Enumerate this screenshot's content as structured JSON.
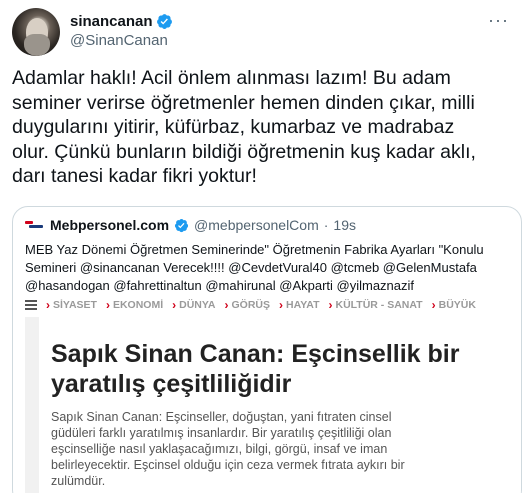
{
  "author": {
    "display_name": "sinancanan",
    "handle": "@SinanCanan",
    "verified_icon": "verified-badge-icon",
    "more_icon": "more-options-icon"
  },
  "tweet": {
    "text": "Adamlar haklı! Acil önlem alınması lazım! Bu adam\nseminer verirse öğretmenler hemen dinden çıkar, milli\nduygularını yitirir, küfürbaz, kumarbaz ve madrabaz\nolur. Çünkü bunların bildiği öğretmenin kuş kadar aklı,\ndarı tanesi kadar fikri yoktur!"
  },
  "quoted_tweet": {
    "display_name": "Mebpersonel.com",
    "handle": "@mebpersonelCom",
    "separator": "·",
    "time": "19s",
    "text": "MEB Yaz Dönemi Öğretmen Seminerinde\" Öğretmenin  Fabrika Ayarları \"Konulu\nSemineri @sinancanan Verecek!!!! @CevdetVural40  @tcmeb @GelenMustafa\n@hasandogan @fahrettinaltun  @mahirunal @Akparti @yilmaznazif"
  },
  "site_nav": {
    "items": [
      {
        "chevron": "›",
        "label": "SİYASET"
      },
      {
        "chevron": "›",
        "label": "EKONOMİ"
      },
      {
        "chevron": "›",
        "label": "DÜNYA"
      },
      {
        "chevron": "›",
        "label": "GÖRÜŞ"
      },
      {
        "chevron": "›",
        "label": "HAYAT"
      },
      {
        "chevron": "›",
        "label": "KÜLTÜR - SANAT"
      },
      {
        "chevron": "›",
        "label": "BÜYÜK"
      }
    ]
  },
  "article": {
    "title": "Sapık Sinan Canan: Eşcinsellik bir yaratılış çeşitliliğidir",
    "body": "Sapık Sinan Canan: Eşcinseller, doğuştan, yani fıtraten cinsel\ngüdüleri farklı yaratılmış insanlardır. Bir yaratılış çeşitliliği olan\neşcinselliğe nasıl yaklaşacağımızı, bilgi, görgü, insaf ve iman\nbelirleyecektir. Eşcinsel olduğu için ceza vermek fıtrata aykırı bir\nzulümdür."
  },
  "colors": {
    "verified": "#1d9bf0",
    "secondary_text": "#536471",
    "nav_chevron": "#d0021b",
    "border": "#cfd9de"
  }
}
